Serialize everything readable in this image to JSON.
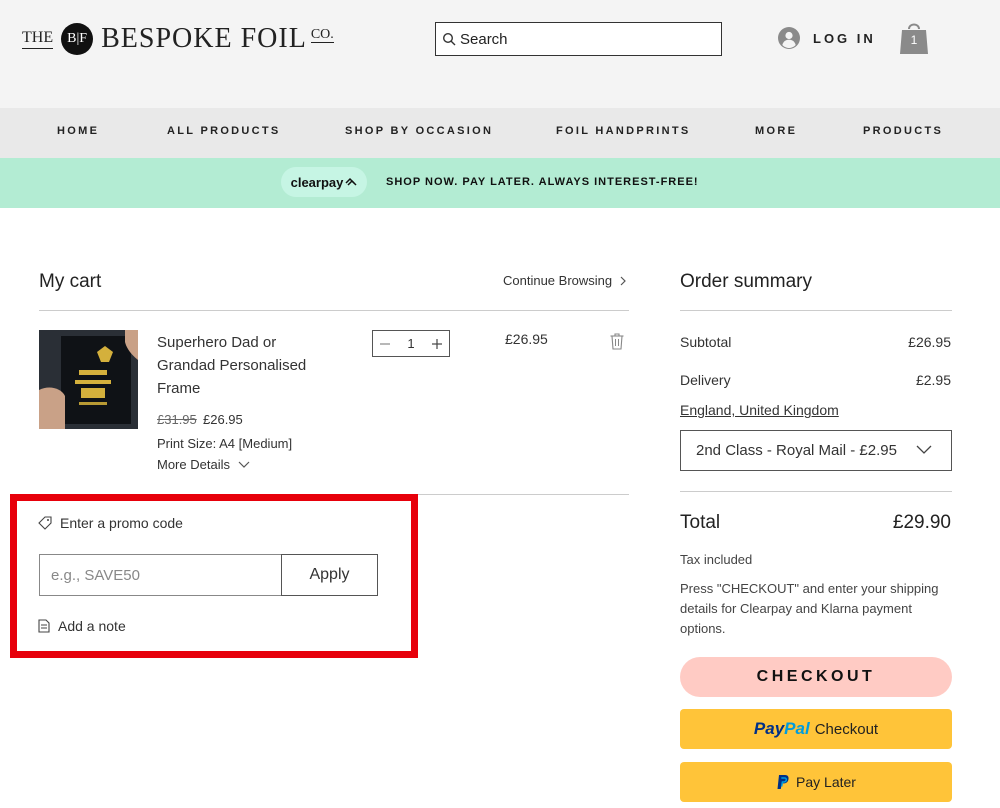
{
  "header": {
    "logo": {
      "the": "THE",
      "monogram": "B|F",
      "name": "BESPOKE FOIL",
      "co": "CO."
    },
    "search": {
      "placeholder": "Search"
    },
    "login_label": "LOG IN",
    "cart_count": "1"
  },
  "nav": {
    "items": [
      {
        "label": "HOME"
      },
      {
        "label": "ALL PRODUCTS"
      },
      {
        "label": "SHOP BY OCCASION"
      },
      {
        "label": "FOIL HANDPRINTS"
      },
      {
        "label": "MORE"
      },
      {
        "label": "PRODUCTS"
      }
    ]
  },
  "banner": {
    "clearpay_label": "clearpay",
    "text": "SHOP NOW. PAY LATER. ALWAYS INTEREST-FREE!",
    "bg_color": "#b3ecd3"
  },
  "cart": {
    "title": "My cart",
    "continue_label": "Continue Browsing",
    "item": {
      "name": "Superhero Dad or Grandad Personalised Frame",
      "price_original": "£31.95",
      "price_sale": "£26.95",
      "option": "Print Size: A4 [Medium]",
      "more_details": "More Details",
      "quantity": "1",
      "line_total": "£26.95"
    },
    "promo": {
      "toggle_label": "Enter a promo code",
      "placeholder": "e.g., SAVE50",
      "apply_label": "Apply"
    },
    "note_label": "Add a note"
  },
  "summary": {
    "title": "Order summary",
    "subtotal_label": "Subtotal",
    "subtotal_value": "£26.95",
    "delivery_label": "Delivery",
    "delivery_value": "£2.95",
    "location": "England, United Kingdom",
    "shipping_option": "2nd Class - Royal Mail - £2.95",
    "total_label": "Total",
    "total_value": "£29.90",
    "tax_note": "Tax included",
    "checkout_note": "Press \"CHECKOUT\" and enter your shipping details for Clearpay and Klarna payment options.",
    "checkout_label": "CHECKOUT",
    "paypal_word1": "Pay",
    "paypal_word2": "Pal",
    "paypal_checkout": "Checkout",
    "paylater_label": "Pay Later"
  },
  "colors": {
    "checkout_bg": "#ffcbc4",
    "paypal_bg": "#ffc439",
    "highlight_border": "#e7000b"
  }
}
